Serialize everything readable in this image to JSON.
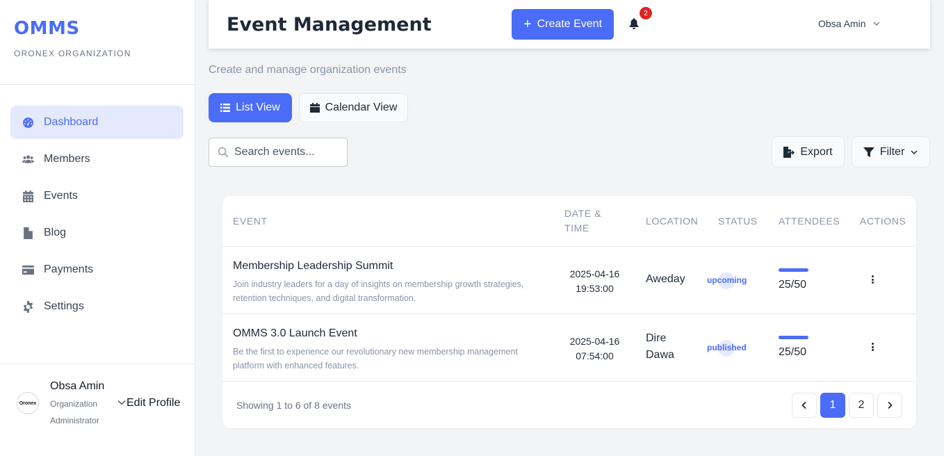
{
  "sidebar": {
    "brand": "OMMS",
    "org": "ORONEX ORGANIZATION",
    "items": [
      {
        "label": "Dashboard",
        "icon": "dashboard-icon",
        "active": true
      },
      {
        "label": "Members",
        "icon": "users-icon"
      },
      {
        "label": "Events",
        "icon": "calendar-icon"
      },
      {
        "label": "Blog",
        "icon": "file-icon"
      },
      {
        "label": "Payments",
        "icon": "credit-card-icon"
      },
      {
        "label": "Settings",
        "icon": "gear-icon"
      }
    ],
    "profile": {
      "avatar_text": "Oronex",
      "name": "Obsa Amin",
      "role_line1": "Organization",
      "role_line2": "Administrator",
      "edit_label": "Edit Profile"
    }
  },
  "header": {
    "title": "Event Management",
    "create_label": "Create Event",
    "notification_count": "2",
    "user_name": "Obsa Amin"
  },
  "subtitle": "Create and manage organization events",
  "views": {
    "list_label": "List View",
    "calendar_label": "Calendar View"
  },
  "search": {
    "placeholder": "Search events..."
  },
  "toolbar": {
    "export_label": "Export",
    "filter_label": "Filter"
  },
  "table": {
    "columns": {
      "event": "EVENT",
      "date_line1": "DATE &",
      "date_line2": "TIME",
      "location": "LOCATION",
      "status": "STATUS",
      "attendees": "ATTENDEES",
      "actions": "ACTIONS"
    },
    "rows": [
      {
        "title": "Membership Leadership Summit",
        "desc_line1": "Join industry leaders for a day of insights on membership growth strategies,",
        "desc_line2": "retention techniques, and digital transformation.",
        "date": "2025-04-16",
        "time": "19:53:00",
        "location_line1": "Aweday",
        "location_line2": "",
        "status": "upcoming",
        "attendees": "25/50",
        "attendance_fraction": 0.5
      },
      {
        "title": "OMMS 3.0 Launch Event",
        "desc_line1": "Be the first to experience our revolutionary new membership management",
        "desc_line2": "platform with enhanced features.",
        "date": "2025-04-16",
        "time": "07:54:00",
        "location_line1": "Dire",
        "location_line2": "Dawa",
        "status": "published",
        "attendees": "25/50",
        "attendance_fraction": 0.5
      }
    ],
    "footer": "Showing 1 to 6 of 8 events",
    "pages": [
      "1",
      "2"
    ],
    "current_page": "1"
  },
  "colors": {
    "accent": "#4a6cf7",
    "accent_soft": "#e5e9fd",
    "badge": "#dc2626"
  }
}
